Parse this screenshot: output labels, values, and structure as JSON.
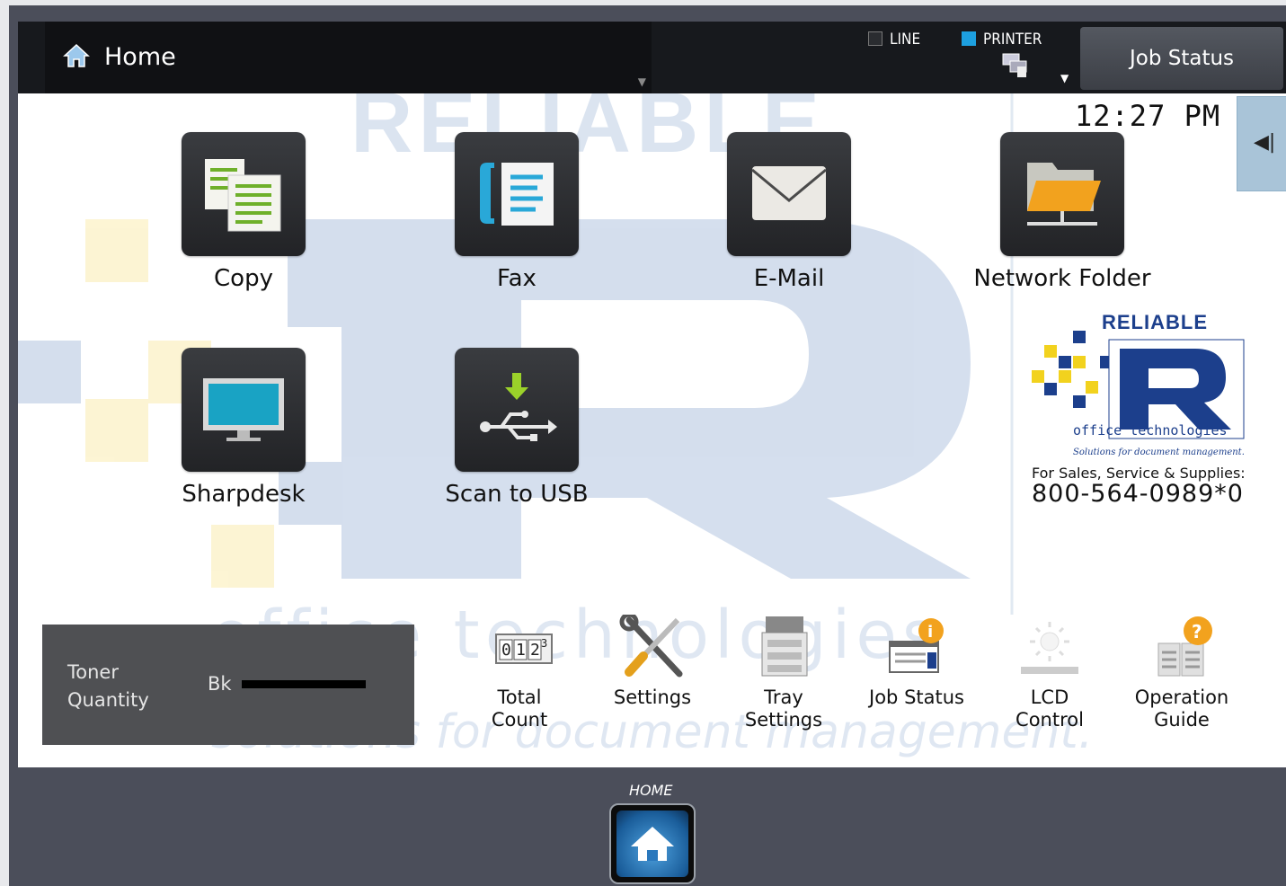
{
  "header": {
    "title": "Home",
    "indicators": [
      {
        "label": "LINE",
        "color": "#2a2c30"
      },
      {
        "label": "PRINTER",
        "color": "#1da0e0"
      }
    ],
    "job_status_button": "Job Status"
  },
  "clock": "12:27 PM",
  "apps": [
    {
      "label": "Copy",
      "icon": "copy-icon"
    },
    {
      "label": "Fax",
      "icon": "fax-icon"
    },
    {
      "label": "E-Mail",
      "icon": "email-icon"
    },
    {
      "label": "Network Folder",
      "icon": "network-folder-icon"
    },
    {
      "label": "Sharpdesk",
      "icon": "monitor-icon"
    },
    {
      "label": "Scan to USB",
      "icon": "usb-icon"
    }
  ],
  "branding": {
    "logo_text": "RELIABLE",
    "logo_sub": "office technologies",
    "logo_tagline": "Solutions for document management.",
    "contact_label": "For Sales, Service & Supplies:",
    "phone": "800-564-0989*0"
  },
  "toner": {
    "label": "Toner Quantity",
    "color_label": "Bk",
    "level": 1.0
  },
  "utilities": [
    {
      "label_lines": [
        "Total",
        "Count"
      ],
      "icon": "counter-icon"
    },
    {
      "label_lines": [
        "Settings"
      ],
      "icon": "settings-tools-icon"
    },
    {
      "label_lines": [
        "Tray",
        "Settings"
      ],
      "icon": "tray-icon"
    },
    {
      "label_lines": [
        "Job Status"
      ],
      "icon": "job-status-icon"
    },
    {
      "label_lines": [
        "LCD",
        "Control"
      ],
      "icon": "brightness-icon"
    },
    {
      "label_lines": [
        "Operation",
        "Guide"
      ],
      "icon": "guide-icon"
    }
  ],
  "home_hw": {
    "label": "HOME"
  },
  "colors": {
    "accent_blue": "#1da0e0",
    "logo_navy": "#1c3f8c",
    "logo_yellow": "#f2d21e"
  }
}
